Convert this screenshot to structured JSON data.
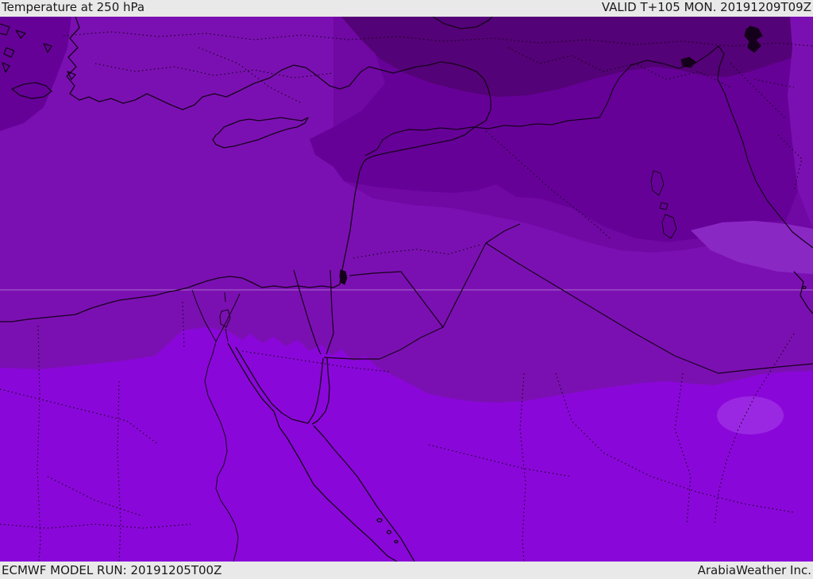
{
  "header": {
    "title": "Temperature at 250 hPa",
    "valid_label": "VALID T+105 MON. 20191209T09Z"
  },
  "footer": {
    "model_run_label": "ECMWF MODEL RUN: 20191205T00Z",
    "credit_label": "ArabiaWeather Inc."
  },
  "map": {
    "colors": {
      "band_coldest": "#540277",
      "band_very_cold": "#660198",
      "band_cold": "#7008a3",
      "band_mid": "#7b10b2",
      "band_mild_patch": "#8a28c4",
      "band_warm": "#8a07d9",
      "band_warmest_patch": "#9a28e2",
      "line_dark": "#16001c",
      "graticule": "#d9c7e6",
      "chrome_background": "#e9e9e9",
      "chrome_text": "#1a1a1a"
    }
  }
}
